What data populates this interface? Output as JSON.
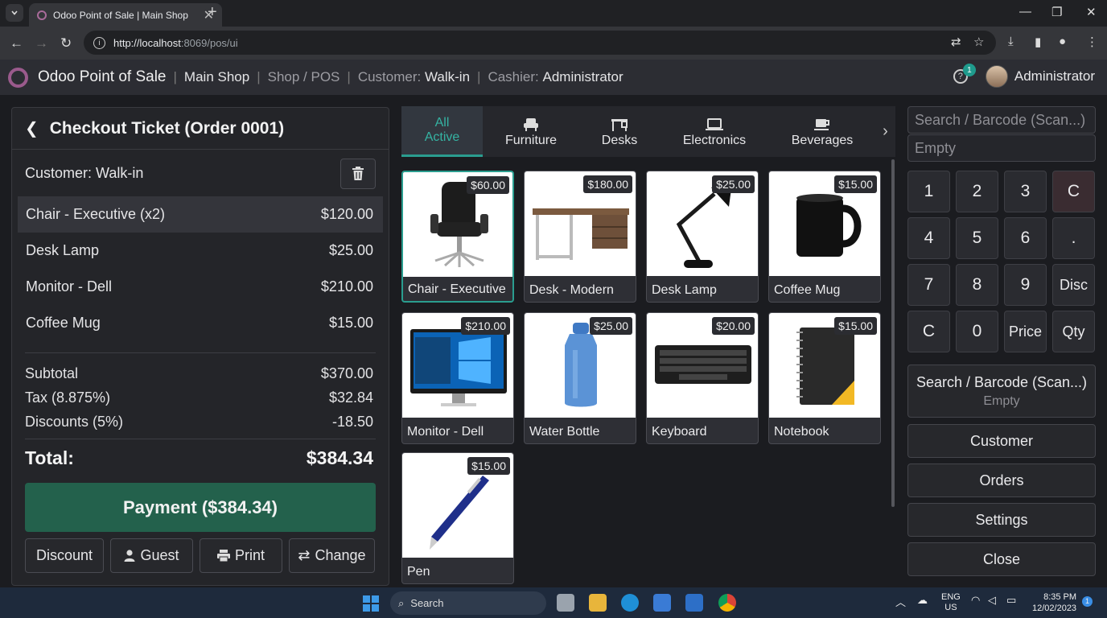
{
  "browser": {
    "tab_title": "Odoo Point of Sale | Main Shop",
    "url_host": "http://localhost",
    "url_rest": ":8069/pos/ui"
  },
  "navbar": {
    "app_name": "Odoo Point of Sale",
    "shop": "Main Shop",
    "breadcrumb": "Shop / POS",
    "customer_label": "Customer:",
    "customer_value": "Walk-in",
    "cashier_label": "Cashier:",
    "cashier_value": "Administrator",
    "notification_count": "1",
    "user_name": "Administrator"
  },
  "ticket": {
    "title": "Checkout Ticket (Order 0001)",
    "customer": "Customer: Walk-in",
    "lines": [
      {
        "name": "Chair - Executive (x2)",
        "amount": "$120.00"
      },
      {
        "name": "Desk Lamp",
        "amount": "$25.00"
      },
      {
        "name": "Monitor - Dell",
        "amount": "$210.00"
      },
      {
        "name": "Coffee Mug",
        "amount": "$15.00"
      }
    ],
    "subtotal_label": "Subtotal",
    "subtotal": "$370.00",
    "tax_label": "Tax (8.875%)",
    "tax": "$32.84",
    "discount_label": "Discounts (5%)",
    "discount": "-18.50",
    "total_label": "Total:",
    "total": "$384.34",
    "payment_label": "Payment ($384.34)",
    "actions": [
      "Discount",
      "Guest",
      "Print",
      "Change"
    ]
  },
  "categories": [
    "All Active",
    "Furniture",
    "Desks",
    "Electronics",
    "Beverages"
  ],
  "category_all_line1": "All",
  "category_all_line2": "Active",
  "products": [
    {
      "name": "Chair - Executive",
      "price": "$60.00"
    },
    {
      "name": "Desk - Modern",
      "price": "$180.00"
    },
    {
      "name": "Desk Lamp",
      "price": "$25.00"
    },
    {
      "name": "Coffee Mug",
      "price": "$15.00"
    },
    {
      "name": "Monitor - Dell",
      "price": "$210.00"
    },
    {
      "name": "Water Bottle",
      "price": "$25.00"
    },
    {
      "name": "Keyboard",
      "price": "$20.00"
    },
    {
      "name": "Notebook",
      "price": "$15.00"
    },
    {
      "name": "Pen",
      "price": "$15.00"
    }
  ],
  "control": {
    "search_placeholder": "Search / Barcode (Scan...)",
    "empty_text": "Empty",
    "keys": [
      "1",
      "2",
      "3",
      "C",
      "4",
      "5",
      "6",
      ".",
      "7",
      "8",
      "9",
      "Disc",
      "C",
      "0",
      "Price",
      "Qty"
    ],
    "search_button": "Search / Barcode (Scan...)",
    "search_button_sub": "Empty",
    "customer_button": "Customer",
    "orders_button": "Orders",
    "settings_button": "Settings",
    "close_button": "Close"
  },
  "taskbar": {
    "search": "Search",
    "lang1": "ENG",
    "lang2": "US",
    "time": "8:35 PM",
    "date": "12/02/2023"
  }
}
